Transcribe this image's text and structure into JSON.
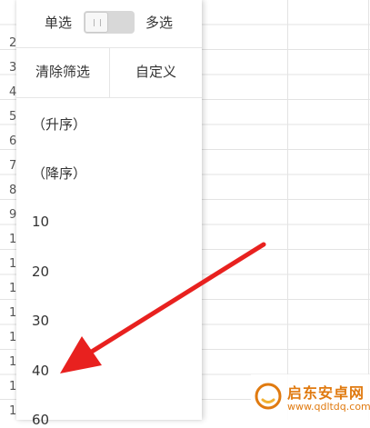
{
  "spreadsheet": {
    "row_numbers": [
      "2",
      "3",
      "4",
      "5",
      "6",
      "7",
      "8",
      "9",
      "1",
      "1",
      "1",
      "1",
      "1",
      "1",
      "1",
      "1"
    ]
  },
  "filter_panel": {
    "mode": {
      "single_label": "单选",
      "multi_label": "多选",
      "multi_enabled": false
    },
    "actions": {
      "clear_label": "清除筛选",
      "custom_label": "自定义"
    },
    "options": [
      "（升序）",
      "（降序）",
      "10",
      "20",
      "30",
      "40",
      "60"
    ]
  },
  "annotation": {
    "arrow_color": "#e8211f"
  },
  "watermark": {
    "name": "启东安卓网",
    "url": "www.qdltdq.com",
    "brand_color": "#e07a10"
  }
}
